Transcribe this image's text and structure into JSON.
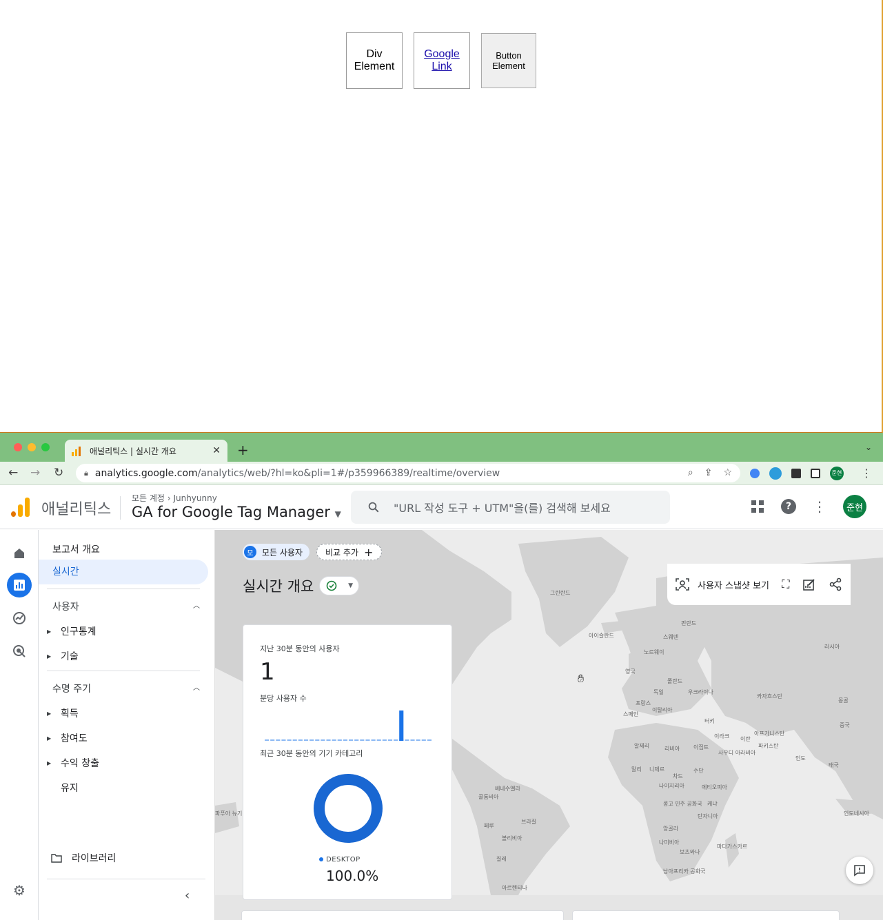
{
  "test_page": {
    "div_element": "Div Element",
    "google_link": "Google Link",
    "button_element": "Button Element"
  },
  "browser": {
    "tab_title": "애널리틱스 | 실시간 개요",
    "url_host": "analytics.google.com",
    "url_path": "/analytics/web/?hl=ko&pli=1#/p359966389/realtime/overview",
    "profile_initials": "준현"
  },
  "ga": {
    "brand": "애널리틱스",
    "breadcrumb_root": "모든 계정",
    "breadcrumb_account": "Junhyunny",
    "property": "GA for Google Tag Manager",
    "search_placeholder": "\"URL 작성 도구 + UTM\"을(를) 검색해 보세요",
    "avatar_initials": "준현"
  },
  "sidenav": {
    "report_overview": "보고서 개요",
    "realtime": "실시간",
    "users_section": "사용자",
    "demographics": "인구통계",
    "tech": "기술",
    "lifecycle_section": "수명 주기",
    "acquisition": "획득",
    "engagement": "참여도",
    "monetization": "수익 창출",
    "retention": "유지",
    "library": "라이브러리"
  },
  "main": {
    "chip_all_users_badge": "모",
    "chip_all_users": "모든 사용자",
    "chip_add_comparison": "비교 추가",
    "page_title": "실시간 개요",
    "snapshot_label": "사용자 스냅샷 보기",
    "card": {
      "users_30min_label": "지난 30분 동안의 사용자",
      "users_30min_value": "1",
      "users_per_min_label": "분당 사용자 수",
      "device_label": "최근 30분 동안의 기기 카테고리",
      "legend_desktop": "DESKTOP",
      "desktop_pct": "100.0%"
    },
    "map_labels": [
      "그린란드",
      "아이슬란드",
      "핀란드",
      "스웨덴",
      "노르웨이",
      "러시아",
      "영국",
      "폴란드",
      "독일",
      "우크라이나",
      "카자흐스탄",
      "프랑스",
      "이탈리아",
      "몽골",
      "스페인",
      "터키",
      "중국",
      "이라크",
      "아프가니스탄",
      "이란",
      "파키스탄",
      "알제리",
      "리비아",
      "이집트",
      "사우디 아라비아",
      "인도",
      "태국",
      "말리",
      "니제르",
      "수단",
      "차드",
      "나이지리아",
      "에티오피아",
      "베네수엘라",
      "콜롬비아",
      "케냐",
      "콩고 민주 공화국",
      "탄자니아",
      "페루",
      "브라질",
      "볼리비아",
      "앙골라",
      "나미비아",
      "마다가스카르",
      "보츠와나",
      "칠레",
      "남아프리카 공화국",
      "아르헨티나",
      "인도네시아",
      "파푸아 뉴기니"
    ]
  },
  "chart_data": {
    "type": "bar",
    "title": "분당 사용자 수",
    "values": [
      0,
      0,
      0,
      0,
      0,
      0,
      0,
      0,
      0,
      0,
      0,
      0,
      0,
      0,
      0,
      0,
      0,
      0,
      0,
      0,
      0,
      0,
      0,
      0,
      1,
      0,
      0,
      0,
      0,
      0
    ],
    "ylim": [
      0,
      1
    ],
    "donut": {
      "type": "pie",
      "categories": [
        "DESKTOP"
      ],
      "values": [
        100.0
      ]
    }
  },
  "colors": {
    "accent": "#1a73e8",
    "tab_bar": "#80c080",
    "ga_orange": "#f9ab00"
  }
}
